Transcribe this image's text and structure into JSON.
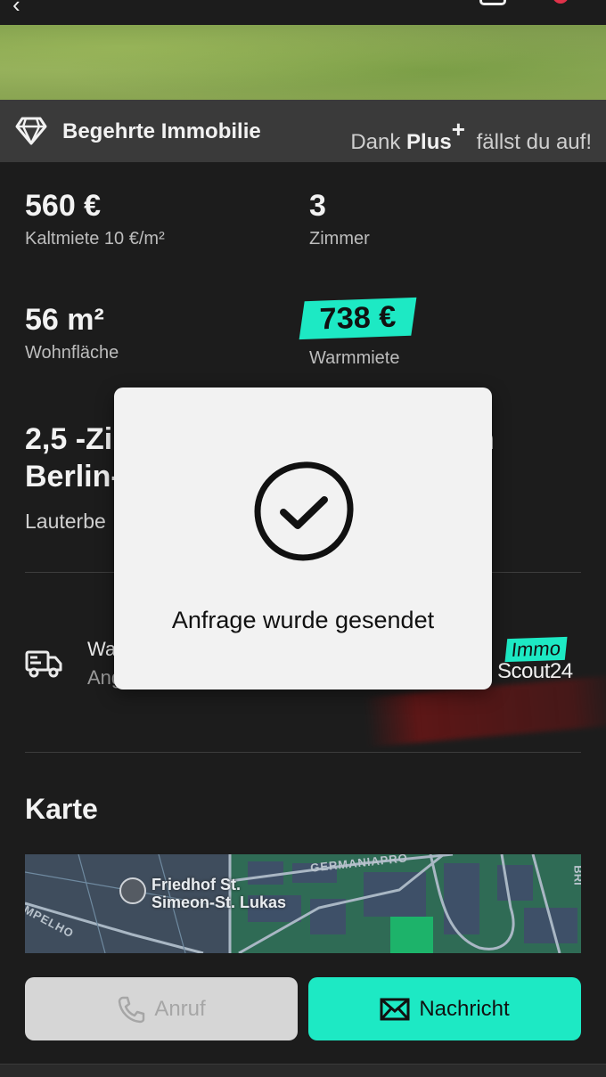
{
  "topbar": {
    "back_icon": "chevron-left-icon",
    "share_icon": "share-icon",
    "favorite_icon": "heart-icon",
    "favorite_color": "#e0324a"
  },
  "plus_banner": {
    "title": "Begehrte Immobilie",
    "promo_prefix": "Dank",
    "promo_brand": "Plus",
    "promo_brand_mark": "+",
    "promo_suffix": "fällst du auf!"
  },
  "facts": {
    "rent": {
      "value": "560 €",
      "label": "Kaltmiete 10 €/m²"
    },
    "rooms": {
      "value": "3",
      "label": "Zimmer"
    },
    "area": {
      "value": "56 m²",
      "label": "Wohnfläche"
    },
    "warm": {
      "value": "738 €",
      "label": "Warmmiete"
    }
  },
  "address": {
    "title_visible": "2,5 -Zi",
    "title_line2_visible": "Berlin-",
    "title_right_fragment": "n",
    "subtitle_visible": "Lauterbe"
  },
  "moving": {
    "icon": "truck-icon",
    "title_visible": "Wa",
    "subtitle_visible": "Ang"
  },
  "brand": {
    "immo": "Immo",
    "scout": "Scout24"
  },
  "map_section": {
    "title": "Karte",
    "poi_name_line1": "Friedhof St.",
    "poi_name_line2": "Simeon-St. Lukas",
    "street_top": "GERMANIAPRO",
    "street_left": "MPELHO",
    "street_right": "BRI"
  },
  "actions": {
    "call_label": "Anruf",
    "message_label": "Nachricht"
  },
  "dialog": {
    "message": "Anfrage wurde gesendet",
    "icon": "checkmark-circle-icon"
  },
  "colors": {
    "accent": "#1de9c4",
    "background": "#1c1c1c",
    "banner": "#3a3a3a"
  }
}
